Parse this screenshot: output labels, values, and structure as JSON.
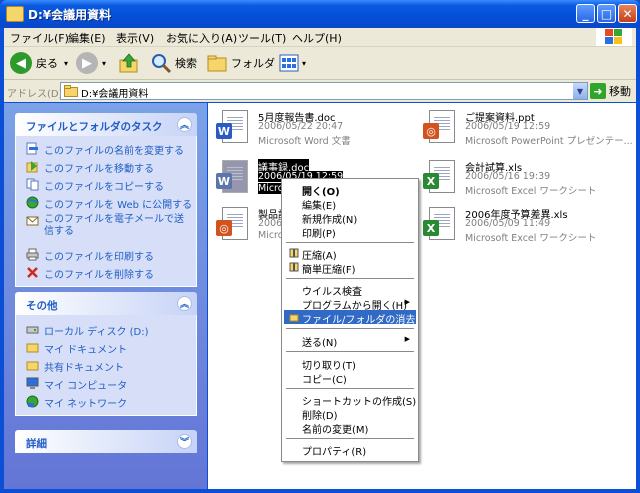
{
  "window": {
    "title": "D:¥会議用資料",
    "minimize": "_",
    "maximize": "□",
    "close": "✕"
  },
  "menu": [
    "ファイル(F)",
    "編集(E)",
    "表示(V)",
    "お気に入り(A)",
    "ツール(T)",
    "ヘルプ(H)"
  ],
  "toolbar": {
    "back": "戻る",
    "search": "検索",
    "folders": "フォルダ"
  },
  "address": {
    "label": "アドレス(D)",
    "path": "D:¥会議用資料",
    "go": "移動"
  },
  "tasks_panel": {
    "title": "ファイルとフォルダのタスク",
    "items": [
      "このファイルの名前を変更する",
      "このファイルを移動する",
      "このファイルをコピーする",
      "このファイルを Web に公開する",
      "このファイルを電子メールで送信する",
      "このファイルを印刷する",
      "このファイルを削除する"
    ]
  },
  "other_panel": {
    "title": "その他",
    "items": [
      "ローカル ディスク (D:)",
      "マイ ドキュメント",
      "共有ドキュメント",
      "マイ コンピュータ",
      "マイ ネットワーク"
    ]
  },
  "details_panel": {
    "title": "詳細"
  },
  "files": [
    {
      "name": "5月度報告書.doc",
      "date": "2006/05/22 20:47",
      "type": "Microsoft Word 文書"
    },
    {
      "name": "ご提案資料.ppt",
      "date": "2006/05/19 12:59",
      "type": "Microsoft PowerPoint プレゼンテー..."
    },
    {
      "name": "議事録.doc",
      "date": "2006/05/19 12:59",
      "type": "Microso"
    },
    {
      "name": "会計試算.xls",
      "date": "2006/05/16 19:39",
      "type": "Microsoft Excel ワークシート"
    },
    {
      "name": "製品説",
      "date": "2006/0",
      "type": "Microso"
    },
    {
      "name": "2006年度予算差異.xls",
      "date": "2006/05/09 11:49",
      "type": "Microsoft Excel ワークシート"
    }
  ],
  "context_menu": [
    "開く(O)",
    "編集(E)",
    "新規作成(N)",
    "印刷(P)",
    "圧縮(A)",
    "簡単圧縮(F)",
    "ウイルス検査",
    "プログラムから開く(H)",
    "ファイル/フォルダの消去",
    "送る(N)",
    "切り取り(T)",
    "コピー(C)",
    "ショートカットの作成(S)",
    "削除(D)",
    "名前の変更(M)",
    "プロパティ(R)"
  ],
  "colors": {
    "accent": "#0a4fd6",
    "selection": "#316ac5",
    "task_link": "#215dc6"
  },
  "icons": [
    "back-arrow-icon",
    "forward-arrow-icon",
    "up-folder-icon",
    "search-icon",
    "folders-icon",
    "views-icon",
    "go-arrow-icon"
  ]
}
